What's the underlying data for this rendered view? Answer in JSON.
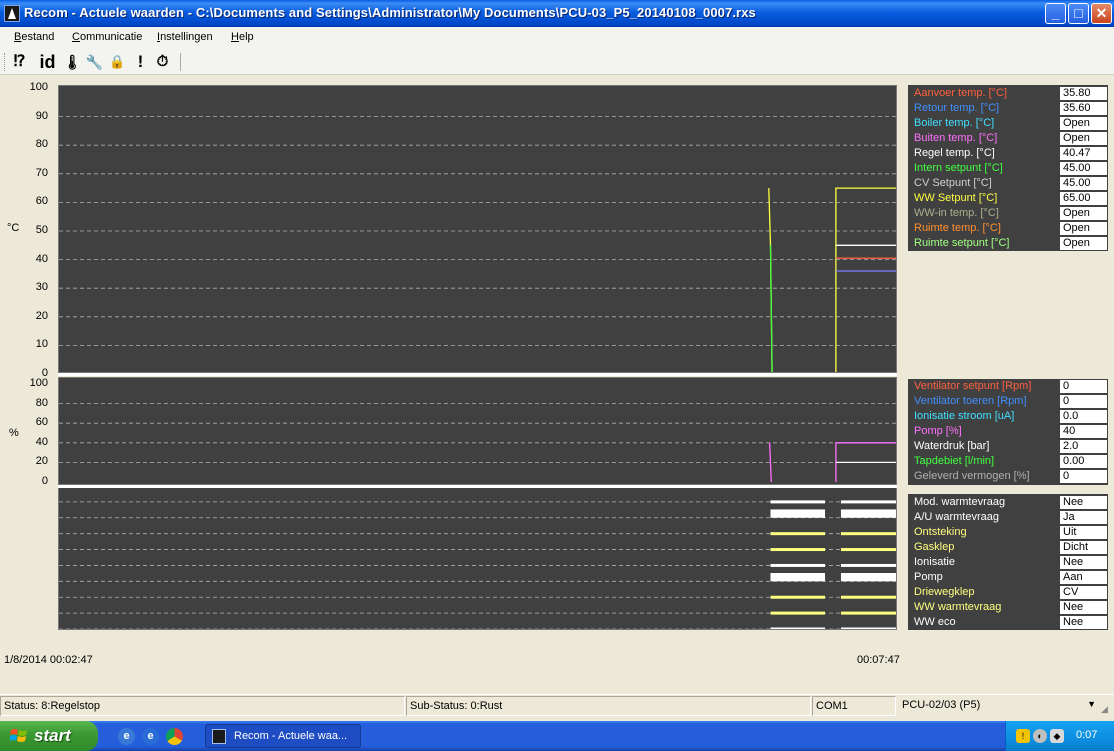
{
  "window": {
    "title": "Recom - Actuele waarden - C:\\Documents and Settings\\Administrator\\My Documents\\PCU-03_P5_20140108_0007.rxs",
    "controls": [
      "minimize",
      "maximize",
      "close"
    ]
  },
  "menu": [
    {
      "label": "Bestand",
      "accel": "B",
      "rest": "estand"
    },
    {
      "label": "Communicatie",
      "accel": "C",
      "rest": "ommunicatie"
    },
    {
      "label": "Instellingen",
      "accel": "I",
      "rest": "nstellingen"
    },
    {
      "label": "Help",
      "accel": "H",
      "rest": "elp"
    }
  ],
  "toolbar": [
    {
      "icon": "question-icon",
      "glyph": "⁉"
    },
    {
      "icon": "id-icon",
      "glyph": "id"
    },
    {
      "icon": "thermometer-icon",
      "glyph": "🌡"
    },
    {
      "icon": "wrench-icon",
      "glyph": "🔧"
    },
    {
      "icon": "lock-icon",
      "glyph": "🔒"
    },
    {
      "icon": "alert-icon",
      "glyph": "!"
    },
    {
      "icon": "stopwatch-icon",
      "glyph": "⏱"
    }
  ],
  "chart_data": [
    {
      "type": "line",
      "name": "temperature",
      "ylabel": "°C",
      "ylim": [
        0,
        100
      ],
      "yticks": [
        0,
        10,
        20,
        30,
        40,
        50,
        60,
        70,
        80,
        90,
        100
      ],
      "grid": true,
      "xlim": [
        0,
        1
      ],
      "series": [
        {
          "name": "WW Setpunt [°C]",
          "color": "#ffff40",
          "segments": [
            [
              [
                0.846,
                65
              ],
              [
                0.848,
                45
              ],
              [
                0.85,
                0
              ]
            ],
            [
              [
                0.926,
                0
              ],
              [
                0.926,
                65
              ],
              [
                1.0,
                65
              ]
            ]
          ]
        },
        {
          "name": "Intern setpunt [°C]",
          "color": "#40ff40",
          "segments": [
            [
              [
                0.848,
                45
              ],
              [
                0.85,
                0
              ]
            ]
          ]
        },
        {
          "name": "Regel temp. [°C]",
          "color": "#ffffff",
          "segments": [
            [
              [
                0.926,
                45
              ],
              [
                1.0,
                45
              ]
            ]
          ]
        },
        {
          "name": "Aanvoer temp. [°C]",
          "color": "#ff6040",
          "segments": [
            [
              [
                0.926,
                40.5
              ],
              [
                1.0,
                40.5
              ]
            ]
          ]
        },
        {
          "name": "Retour temp. [°C]",
          "color": "#8080ff",
          "segments": [
            [
              [
                0.926,
                36
              ],
              [
                1.0,
                36
              ]
            ]
          ]
        }
      ]
    },
    {
      "type": "line",
      "name": "percent",
      "ylabel": "%",
      "ylim": [
        0,
        100
      ],
      "yticks": [
        0,
        20,
        40,
        60,
        80,
        100
      ],
      "grid": true,
      "xlim": [
        0,
        1
      ],
      "series": [
        {
          "name": "Pomp [%]",
          "color": "#ff70ff",
          "segments": [
            [
              [
                0.847,
                40
              ],
              [
                0.849,
                0
              ]
            ],
            [
              [
                0.926,
                0
              ],
              [
                0.926,
                40
              ],
              [
                1.0,
                40
              ]
            ]
          ]
        },
        {
          "name": "Waterdruk [bar]",
          "color": "#ffffff",
          "segments": [
            [
              [
                0.926,
                20
              ],
              [
                1.0,
                20
              ]
            ]
          ]
        }
      ]
    },
    {
      "type": "line",
      "name": "digital",
      "rows": [
        "Mod. warmtevraag",
        "A/U warmtevraag",
        "Ontsteking",
        "Gasklep",
        "Ionisatie",
        "Pomp",
        "Driewegklep",
        "WW warmtevraag",
        "WW eco"
      ],
      "xlim": [
        0,
        1
      ],
      "series": [
        {
          "name": "Mod. warmtevraag",
          "color": "#ffffff",
          "on": [
            [
              0.848,
              0.913
            ],
            [
              0.932,
              1.0
            ]
          ],
          "state": 0
        },
        {
          "name": "A/U warmtevraag",
          "color": "#ffffff",
          "on": [
            [
              0.848,
              0.913
            ],
            [
              0.932,
              1.0
            ]
          ],
          "state": 1
        },
        {
          "name": "Ontsteking",
          "color": "#ffff80",
          "on": [
            [
              0.848,
              0.913
            ],
            [
              0.932,
              1.0
            ]
          ],
          "state": 0
        },
        {
          "name": "Gasklep",
          "color": "#ffff80",
          "on": [
            [
              0.848,
              0.913
            ],
            [
              0.932,
              1.0
            ]
          ],
          "state": 0
        },
        {
          "name": "Ionisatie",
          "color": "#ffffff",
          "on": [
            [
              0.848,
              0.913
            ],
            [
              0.932,
              1.0
            ]
          ],
          "state": 0
        },
        {
          "name": "Pomp",
          "color": "#ffffff",
          "on": [
            [
              0.848,
              0.913
            ],
            [
              0.932,
              1.0
            ]
          ],
          "state": 1
        },
        {
          "name": "Driewegklep",
          "color": "#ffff80",
          "on": [
            [
              0.848,
              0.913
            ],
            [
              0.932,
              1.0
            ]
          ],
          "state": 0
        },
        {
          "name": "WW warmtevraag",
          "color": "#ffff80",
          "on": [
            [
              0.848,
              0.913
            ],
            [
              0.932,
              1.0
            ]
          ],
          "state": 0
        },
        {
          "name": "WW eco",
          "color": "#ffffff",
          "on": [
            [
              0.848,
              0.913
            ],
            [
              0.932,
              1.0
            ]
          ],
          "state": 0
        }
      ]
    }
  ],
  "chart_colors": {
    "background": "#404040",
    "grid": "#b0b0b0",
    "divider": "#ffffff"
  },
  "time_axis": {
    "start": "1/8/2014 00:02:47",
    "end": "00:07:47"
  },
  "side_panels": [
    {
      "id": "temperature",
      "rows": [
        {
          "label": "Aanvoer temp. [°C]",
          "value": "35.80",
          "color": "#ff6040"
        },
        {
          "label": "Retour temp. [°C]",
          "value": "35.60",
          "color": "#4090ff"
        },
        {
          "label": "Boiler temp. [°C]",
          "value": "Open",
          "color": "#40e0ff"
        },
        {
          "label": "Buiten temp. [°C]",
          "value": "Open",
          "color": "#ff70ff"
        },
        {
          "label": "Regel temp. [°C]",
          "value": "40.47",
          "color": "#ffffff"
        },
        {
          "label": "Intern setpunt [°C]",
          "value": "45.00",
          "color": "#40ff40"
        },
        {
          "label": "CV Setpunt [°C]",
          "value": "45.00",
          "color": "#d0d0d0"
        },
        {
          "label": "WW Setpunt [°C]",
          "value": "65.00",
          "color": "#ffff40"
        },
        {
          "label": "WW-in temp. [°C]",
          "value": "Open",
          "color": "#b0b090"
        },
        {
          "label": "Ruimte temp. [°C]",
          "value": "Open",
          "color": "#ff9030"
        },
        {
          "label": "Ruimte setpunt [°C]",
          "value": "Open",
          "color": "#a0ff80"
        }
      ]
    },
    {
      "id": "percent",
      "rows": [
        {
          "label": "Ventilator setpunt [Rpm]",
          "value": "0",
          "color": "#ff6040"
        },
        {
          "label": "Ventilator toeren [Rpm]",
          "value": "0",
          "color": "#4090ff"
        },
        {
          "label": "Ionisatie stroom [uA]",
          "value": "0.0",
          "color": "#40e0ff"
        },
        {
          "label": "Pomp [%]",
          "value": "40",
          "color": "#ff70ff"
        },
        {
          "label": "Waterdruk [bar]",
          "value": "2.0",
          "color": "#ffffff"
        },
        {
          "label": "Tapdebiet [l/min]",
          "value": "0.00",
          "color": "#40ff40"
        },
        {
          "label": "Geleverd vermogen [%]",
          "value": "0",
          "color": "#b0b0b0"
        }
      ]
    },
    {
      "id": "digital",
      "rows": [
        {
          "label": "Mod. warmtevraag",
          "value": "Nee",
          "color": "#ffffff"
        },
        {
          "label": "A/U warmtevraag",
          "value": "Ja",
          "color": "#ffffff"
        },
        {
          "label": "Ontsteking",
          "value": "Uit",
          "color": "#ffff80"
        },
        {
          "label": "Gasklep",
          "value": "Dicht",
          "color": "#ffff80"
        },
        {
          "label": "Ionisatie",
          "value": "Nee",
          "color": "#ffffff"
        },
        {
          "label": "Pomp",
          "value": "Aan",
          "color": "#ffffff"
        },
        {
          "label": "Driewegklep",
          "value": "CV",
          "color": "#ffff80"
        },
        {
          "label": "WW warmtevraag",
          "value": "Nee",
          "color": "#ffff80"
        },
        {
          "label": "WW eco",
          "value": "Nee",
          "color": "#ffffff"
        }
      ]
    }
  ],
  "statusbar": {
    "status": "Status: 8:Regelstop",
    "substatus": "Sub-Status: 0:Rust",
    "port": "COM1",
    "device": "PCU-02/03 (P5)"
  },
  "taskbar": {
    "start": "start",
    "task": "Recom - Actuele waa...",
    "clock": "0:07"
  }
}
